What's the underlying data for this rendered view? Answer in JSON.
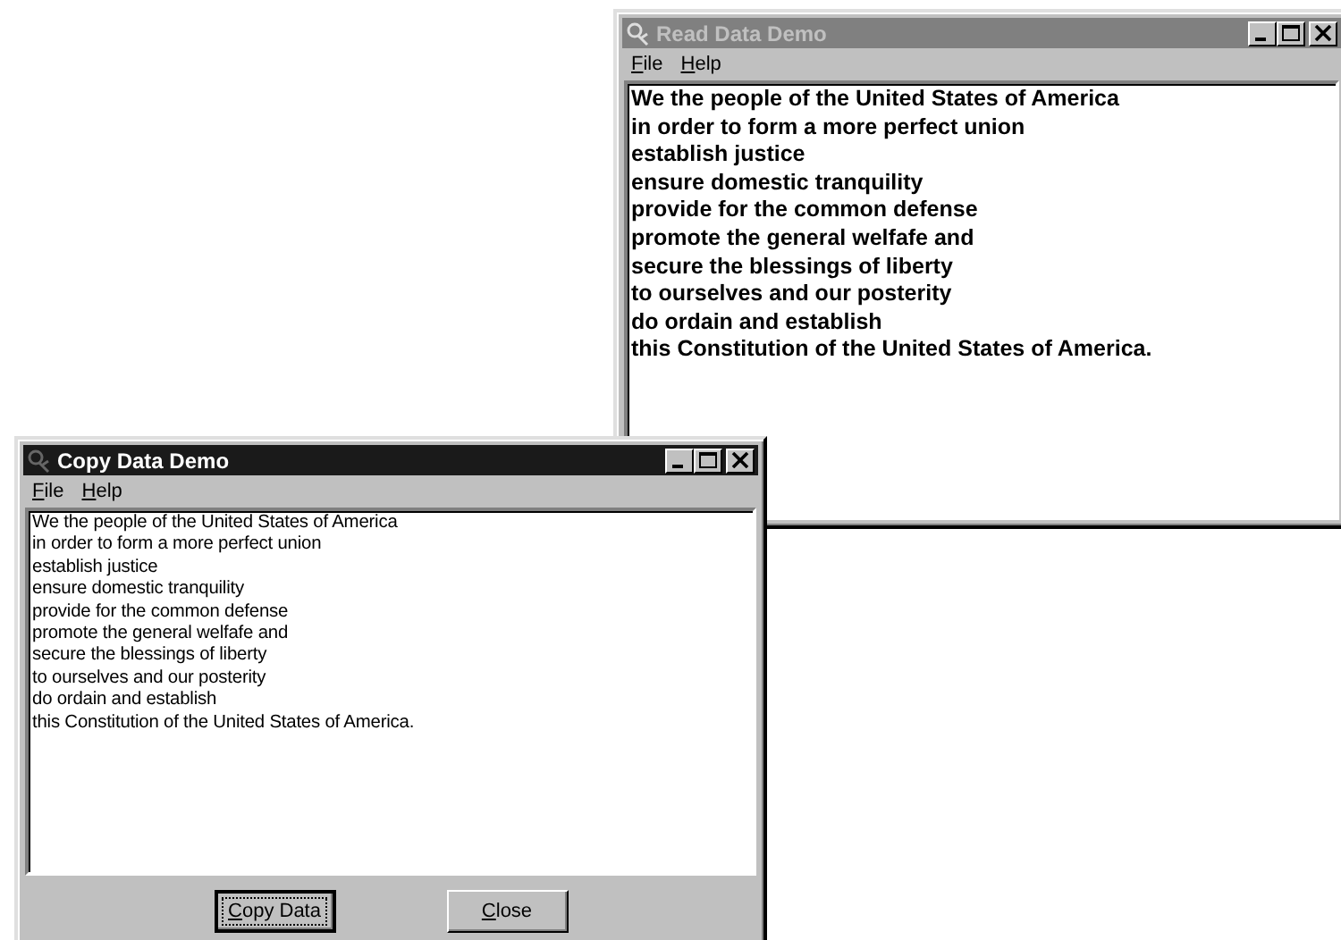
{
  "windows": [
    {
      "kind": "reader",
      "title": "Read Data Demo",
      "active": false,
      "menu": [
        {
          "label": "File",
          "mnemonic_first": true
        },
        {
          "label": "Help",
          "mnemonic_first": true
        }
      ],
      "lines": [
        "We the people of the United States of America",
        "in order to form a more perfect union",
        "establish justice",
        "ensure domestic tranquility",
        "provide for the common defense",
        "promote the general welfafe and",
        "secure the blessings of liberty",
        "to ourselves and our posterity",
        "do ordain and establish",
        "this Constitution of the United States of America."
      ]
    },
    {
      "kind": "copier",
      "title": "Copy Data Demo",
      "active": true,
      "menu": [
        {
          "label": "File",
          "mnemonic_first": true
        },
        {
          "label": "Help",
          "mnemonic_first": true
        }
      ],
      "lines": [
        "We the people of the United States of America",
        "in order to form a more perfect union",
        "establish justice",
        "ensure domestic tranquility",
        "provide for the common defense",
        "promote the general welfafe and",
        "secure the blessings of liberty",
        "to ourselves and our posterity",
        "do ordain and establish",
        "this Constitution of the United States of America."
      ],
      "buttons": [
        {
          "label": "Copy Data",
          "mnemonic_first": true,
          "focused": true
        },
        {
          "label": "Close",
          "mnemonic_first": true,
          "focused": false
        }
      ]
    }
  ]
}
